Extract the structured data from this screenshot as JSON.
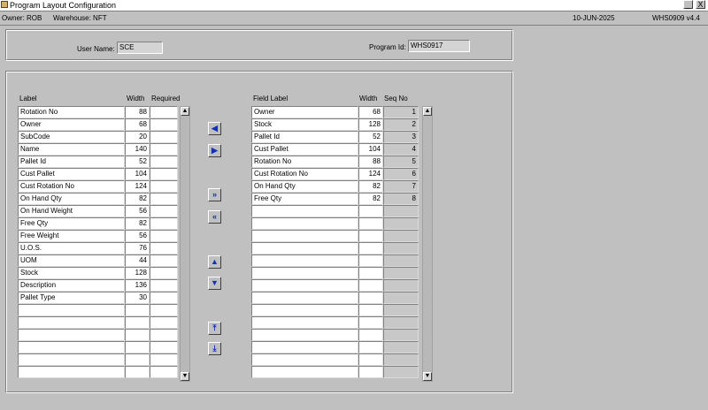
{
  "window": {
    "title": "Program Layout Configuration",
    "minimize": "_",
    "close": "X"
  },
  "infobar": {
    "owner": "Owner:  ROB",
    "warehouse": "Warehouse:  NFT",
    "date": "10-JUN-2025",
    "program": "WHS0909  v4.4"
  },
  "header": {
    "user_label": "User Name:",
    "user_value": "SCE",
    "program_label": "Program Id:",
    "program_value": "WHS0917"
  },
  "left_table": {
    "col_label": "Label",
    "col_width": "Width",
    "col_required": "Required",
    "rows": [
      {
        "label": "Rotation No",
        "width": "88"
      },
      {
        "label": "Owner",
        "width": "68"
      },
      {
        "label": "SubCode",
        "width": "20"
      },
      {
        "label": "Name",
        "width": "140"
      },
      {
        "label": "Pallet Id",
        "width": "52"
      },
      {
        "label": "Cust Pallet",
        "width": "104"
      },
      {
        "label": "Cust Rotation No",
        "width": "124"
      },
      {
        "label": "On Hand Qty",
        "width": "82"
      },
      {
        "label": "On Hand Weight",
        "width": "56"
      },
      {
        "label": "Free Qty",
        "width": "82"
      },
      {
        "label": "Free Weight",
        "width": "56"
      },
      {
        "label": "U.O.S.",
        "width": "76"
      },
      {
        "label": "UOM",
        "width": "44"
      },
      {
        "label": "Stock",
        "width": "128"
      },
      {
        "label": "Description",
        "width": "136"
      },
      {
        "label": "Pallet Type",
        "width": "30"
      },
      {
        "label": "",
        "width": ""
      },
      {
        "label": "",
        "width": ""
      },
      {
        "label": "",
        "width": ""
      },
      {
        "label": "",
        "width": ""
      },
      {
        "label": "",
        "width": ""
      },
      {
        "label": "",
        "width": ""
      }
    ]
  },
  "right_table": {
    "col_label": "Field Label",
    "col_width": "Width",
    "col_seq": "Seq No",
    "rows": [
      {
        "label": "Owner",
        "width": "68",
        "seq": "1"
      },
      {
        "label": "Stock",
        "width": "128",
        "seq": "2"
      },
      {
        "label": "Pallet Id",
        "width": "52",
        "seq": "3"
      },
      {
        "label": "Cust Pallet",
        "width": "104",
        "seq": "4"
      },
      {
        "label": "Rotation No",
        "width": "88",
        "seq": "5"
      },
      {
        "label": "Cust Rotation No",
        "width": "124",
        "seq": "6"
      },
      {
        "label": "On Hand Qty",
        "width": "82",
        "seq": "7"
      },
      {
        "label": "Free Qty",
        "width": "82",
        "seq": "8"
      },
      {
        "label": "",
        "width": "",
        "seq": ""
      },
      {
        "label": "",
        "width": "",
        "seq": ""
      },
      {
        "label": "",
        "width": "",
        "seq": ""
      },
      {
        "label": "",
        "width": "",
        "seq": ""
      },
      {
        "label": "",
        "width": "",
        "seq": ""
      },
      {
        "label": "",
        "width": "",
        "seq": ""
      },
      {
        "label": "",
        "width": "",
        "seq": ""
      },
      {
        "label": "",
        "width": "",
        "seq": ""
      },
      {
        "label": "",
        "width": "",
        "seq": ""
      },
      {
        "label": "",
        "width": "",
        "seq": ""
      },
      {
        "label": "",
        "width": "",
        "seq": ""
      },
      {
        "label": "",
        "width": "",
        "seq": ""
      },
      {
        "label": "",
        "width": "",
        "seq": ""
      },
      {
        "label": "",
        "width": "",
        "seq": ""
      }
    ]
  },
  "buttons": {
    "move_left": "◀",
    "move_right": "▶",
    "move_all_right": "»",
    "move_all_left": "«",
    "move_up": "▲",
    "move_down": "▼",
    "move_top": "⤒",
    "move_bottom": "⤓"
  },
  "scroll": {
    "up": "▲",
    "down": "▼"
  },
  "icons": {
    "app": "app-icon"
  },
  "colors": {
    "background": "#c0c0c0",
    "arrow": "#1030c0",
    "seq_cell": "#c8c8c8"
  }
}
